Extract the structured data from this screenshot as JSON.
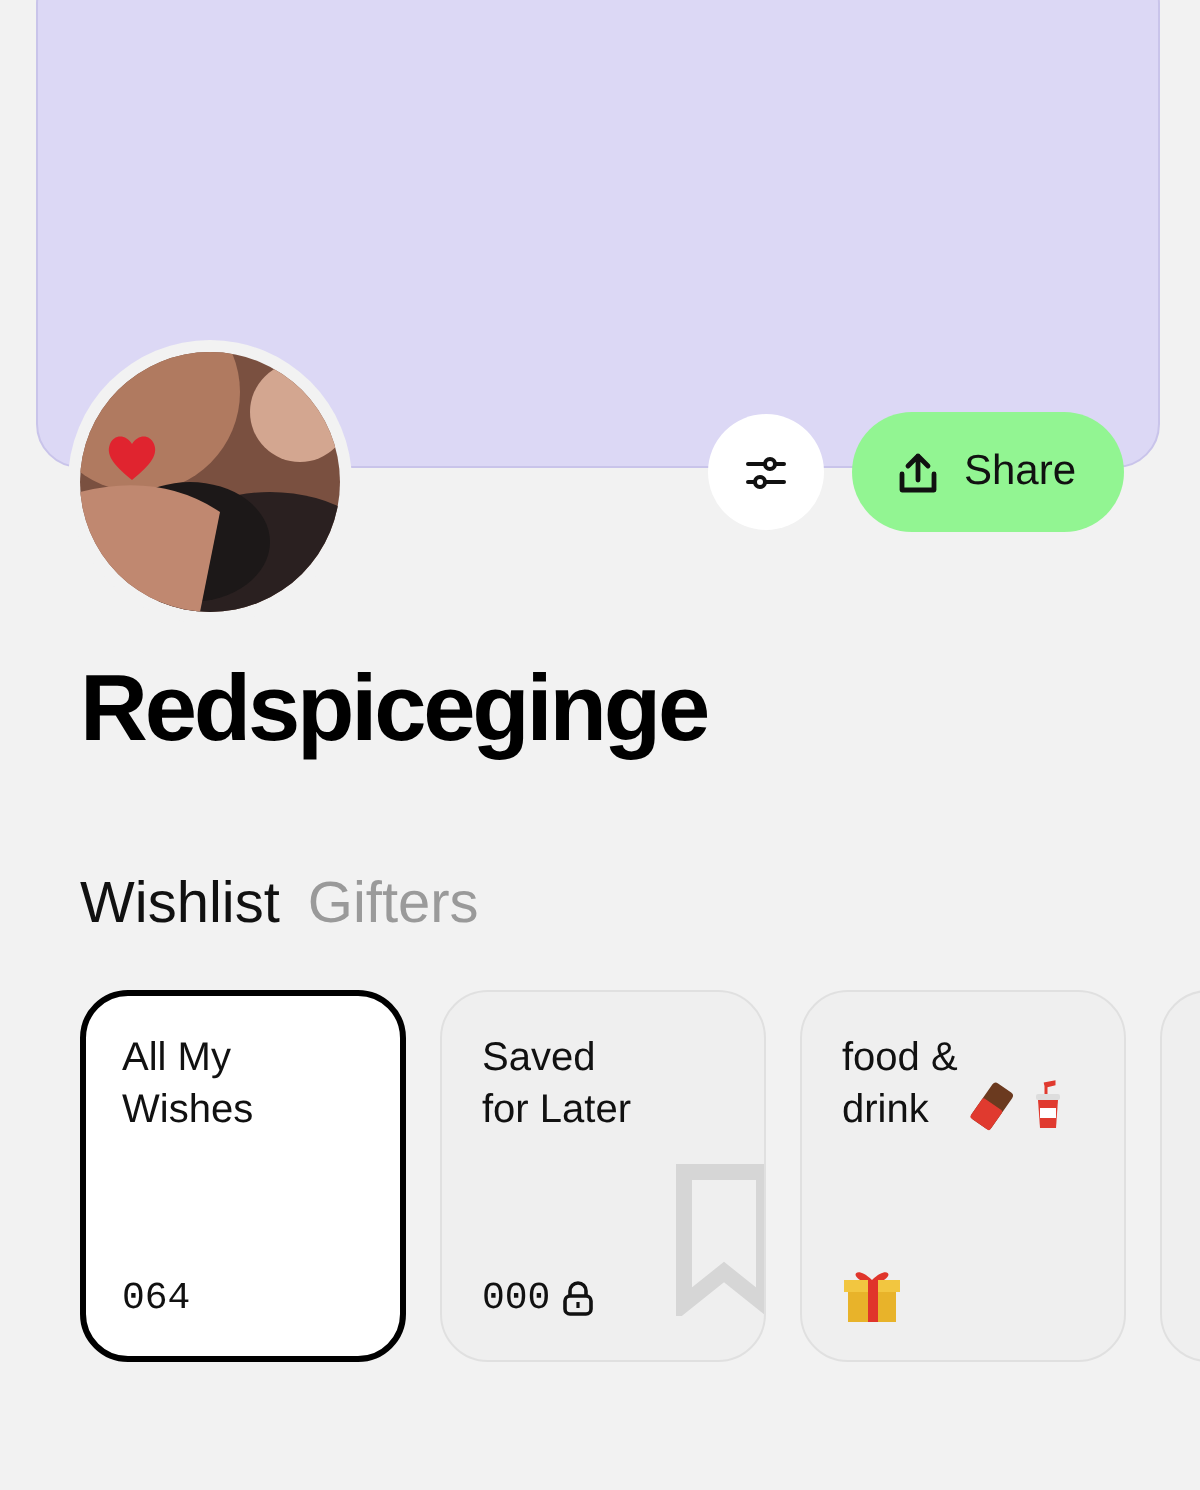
{
  "profile": {
    "name": "Redspiceginge"
  },
  "actions": {
    "share_button": {
      "label": "Share"
    }
  },
  "tabs": [
    {
      "label": "Wishlist",
      "selected": true
    },
    {
      "label": "Gifters",
      "selected": false
    }
  ],
  "lists": [
    {
      "title": "All My\nWishes",
      "count": "064",
      "kind": "plain",
      "selected": true
    },
    {
      "title": "Saved\nfor Later",
      "count": "000",
      "kind": "saved",
      "locked": true,
      "selected": false
    },
    {
      "title": "food &\ndrink",
      "kind": "gift",
      "selected": false
    },
    {
      "kind": "plain",
      "selected": false
    }
  ]
}
